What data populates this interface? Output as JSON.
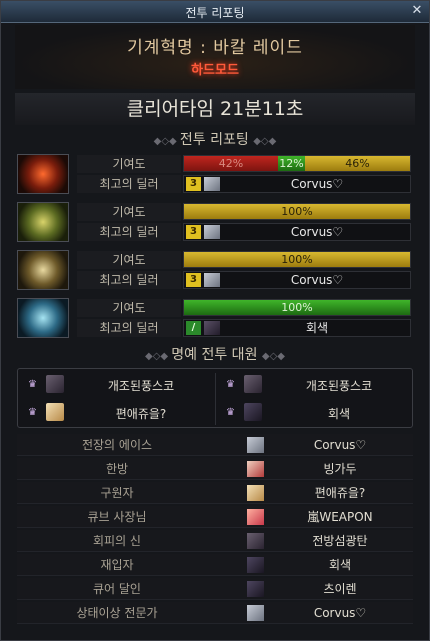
{
  "window": {
    "title": "전투 리포팅",
    "close_icon": "close-icon"
  },
  "header": {
    "raid_name": "기계혁명 : 바칼 레이드",
    "difficulty": "하드모드"
  },
  "clear_time": "클리어타임 21분11초",
  "report_section": {
    "title": "전투 리포팅"
  },
  "labels": {
    "contribution": "기여도",
    "best_dealer": "최고의 딜러"
  },
  "party": [
    {
      "portrait": "flame-mask-portrait",
      "contribution": [
        {
          "value": "42%",
          "color": "red",
          "fraction": 0.42
        },
        {
          "value": "12%",
          "color": "green",
          "fraction": 0.12
        },
        {
          "value": "46%",
          "color": "yellow",
          "fraction": 0.46
        }
      ],
      "dealer_slot": "3",
      "dealer_name": "Corvus♡"
    },
    {
      "portrait": "green-wing-portrait",
      "contribution": [
        {
          "value": "100%",
          "color": "yellow",
          "fraction": 1.0
        }
      ],
      "dealer_slot": "3",
      "dealer_name": "Corvus♡"
    },
    {
      "portrait": "gold-wing-portrait",
      "contribution": [
        {
          "value": "100%",
          "color": "yellow",
          "fraction": 1.0
        }
      ],
      "dealer_slot": "3",
      "dealer_name": "Corvus♡"
    },
    {
      "portrait": "ice-wing-portrait",
      "contribution": [
        {
          "value": "100%",
          "color": "green",
          "fraction": 1.0
        }
      ],
      "dealer_slot": "/",
      "dealer_name": "회색"
    }
  ],
  "honor_section": {
    "title": "명예 전투 대원",
    "members": [
      "개조된풍스코",
      "개조된풍스코",
      "편애쥬을?",
      "회색"
    ]
  },
  "awards": [
    {
      "title": "전장의 에이스",
      "winner": "Corvus♡"
    },
    {
      "title": "한방",
      "winner": "빙가두"
    },
    {
      "title": "구원자",
      "winner": "편애쥬을?"
    },
    {
      "title": "큐브 사장님",
      "winner": "嵐WEAPON"
    },
    {
      "title": "회피의 신",
      "winner": "전방섬광탄"
    },
    {
      "title": "재입자",
      "winner": "회색"
    },
    {
      "title": "큐어 달인",
      "winner": "츠이렌"
    },
    {
      "title": "상태이상 전문가",
      "winner": "Corvus♡"
    }
  ]
}
